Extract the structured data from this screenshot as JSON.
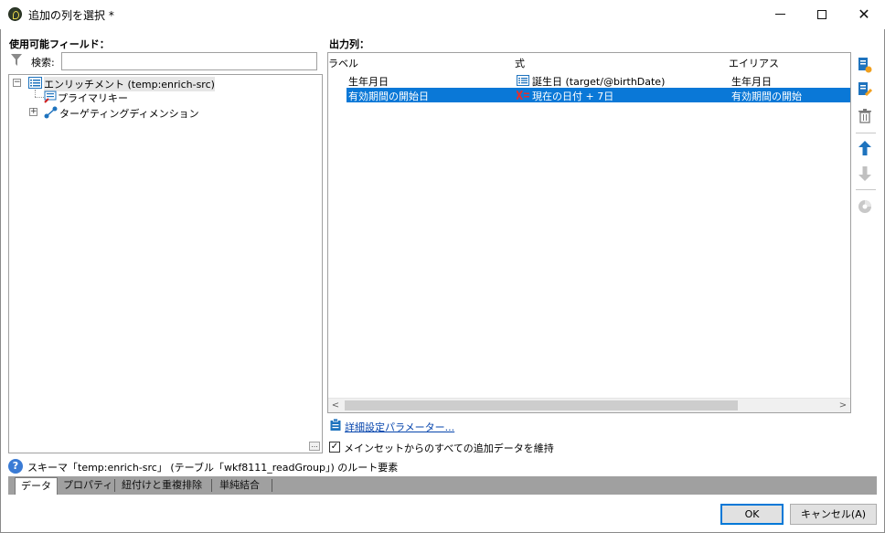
{
  "window": {
    "title": "追加の列を選択 *"
  },
  "left": {
    "section_label": "使用可能フィールド：",
    "search_label": "検索:",
    "search_value": "",
    "tree": [
      {
        "label": "エンリッチメント (temp:enrich-src)",
        "expander": "−"
      },
      {
        "label": "プライマリキー"
      },
      {
        "label": "ターゲティングディメンション",
        "expander": "+"
      }
    ],
    "more_button": "..."
  },
  "right": {
    "section_label": "出力列：",
    "columns": [
      "ラベル",
      "式",
      "エイリアス"
    ],
    "rows": [
      {
        "label": "生年月日",
        "expression": "誕生日 (target/@birthDate)",
        "alias": "生年月日",
        "selected": false
      },
      {
        "label": "有効期間の開始日",
        "expression": "現在の日付 + 7日",
        "alias": "有効期間の開始",
        "selected": true
      }
    ],
    "advanced_link": "詳細設定パラメーター...",
    "keep_checkbox_label": "メインセットからのすべての追加データを維持",
    "keep_checked": true
  },
  "status": {
    "text": "スキーマ「temp:enrich-src」 (テーブル「wkf8111_readGroup」) のルート要素"
  },
  "tabs": [
    "データ",
    "プロパティ",
    "紐付けと重複排除",
    "単純結合"
  ],
  "buttons": {
    "ok": "OK",
    "cancel": "キャンセル(A)"
  },
  "colors": {
    "selection": "#0a78d7",
    "link": "#0645ad",
    "icon_blue": "#1e73be",
    "default_button_border": "#0078d7"
  }
}
